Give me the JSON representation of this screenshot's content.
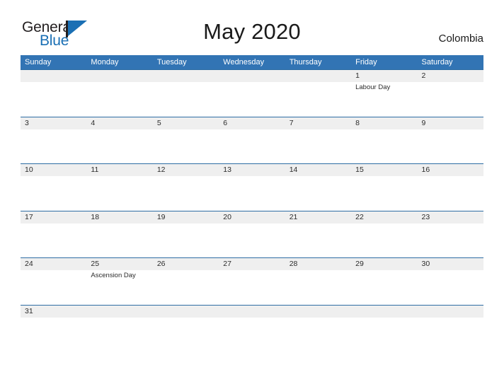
{
  "branding": {
    "logo_text_primary": "General",
    "logo_text_secondary": "Blue",
    "logo_icon": "flag-triangle-icon",
    "accent_color": "#1a6fb4"
  },
  "header": {
    "title": "May 2020",
    "country": "Colombia"
  },
  "theme": {
    "header_row_bg": "#3274b4",
    "row_rule_color": "#2e6da4",
    "date_band_bg": "#efefef",
    "text_color": "#2b2b2b"
  },
  "calendar": {
    "month": "May",
    "year": "2020",
    "weekday_headers": [
      "Sunday",
      "Monday",
      "Tuesday",
      "Wednesday",
      "Thursday",
      "Friday",
      "Saturday"
    ],
    "weeks": [
      [
        {
          "day": "",
          "event": ""
        },
        {
          "day": "",
          "event": ""
        },
        {
          "day": "",
          "event": ""
        },
        {
          "day": "",
          "event": ""
        },
        {
          "day": "",
          "event": ""
        },
        {
          "day": "1",
          "event": "Labour Day"
        },
        {
          "day": "2",
          "event": ""
        }
      ],
      [
        {
          "day": "3",
          "event": ""
        },
        {
          "day": "4",
          "event": ""
        },
        {
          "day": "5",
          "event": ""
        },
        {
          "day": "6",
          "event": ""
        },
        {
          "day": "7",
          "event": ""
        },
        {
          "day": "8",
          "event": ""
        },
        {
          "day": "9",
          "event": ""
        }
      ],
      [
        {
          "day": "10",
          "event": ""
        },
        {
          "day": "11",
          "event": ""
        },
        {
          "day": "12",
          "event": ""
        },
        {
          "day": "13",
          "event": ""
        },
        {
          "day": "14",
          "event": ""
        },
        {
          "day": "15",
          "event": ""
        },
        {
          "day": "16",
          "event": ""
        }
      ],
      [
        {
          "day": "17",
          "event": ""
        },
        {
          "day": "18",
          "event": ""
        },
        {
          "day": "19",
          "event": ""
        },
        {
          "day": "20",
          "event": ""
        },
        {
          "day": "21",
          "event": ""
        },
        {
          "day": "22",
          "event": ""
        },
        {
          "day": "23",
          "event": ""
        }
      ],
      [
        {
          "day": "24",
          "event": ""
        },
        {
          "day": "25",
          "event": "Ascension Day"
        },
        {
          "day": "26",
          "event": ""
        },
        {
          "day": "27",
          "event": ""
        },
        {
          "day": "28",
          "event": ""
        },
        {
          "day": "29",
          "event": ""
        },
        {
          "day": "30",
          "event": ""
        }
      ],
      [
        {
          "day": "31",
          "event": ""
        },
        {
          "day": "",
          "event": ""
        },
        {
          "day": "",
          "event": ""
        },
        {
          "day": "",
          "event": ""
        },
        {
          "day": "",
          "event": ""
        },
        {
          "day": "",
          "event": ""
        },
        {
          "day": "",
          "event": ""
        }
      ]
    ]
  }
}
